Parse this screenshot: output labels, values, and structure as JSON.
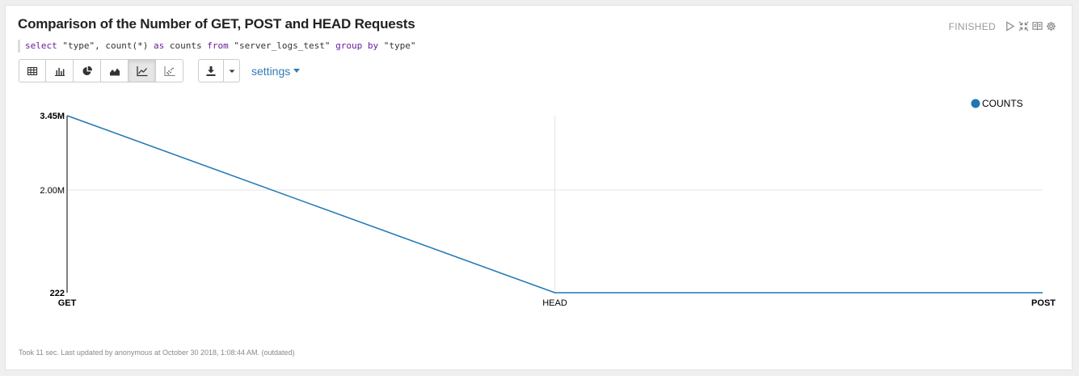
{
  "paragraph": {
    "title": "Comparison of the Number of GET, POST and HEAD Requests",
    "status": "FINISHED",
    "query": {
      "tokens": [
        {
          "t": "select",
          "k": "kw"
        },
        {
          "t": " \"type\", count(*) ",
          "k": "str"
        },
        {
          "t": "as",
          "k": "kw"
        },
        {
          "t": " counts ",
          "k": "str"
        },
        {
          "t": "from",
          "k": "kw"
        },
        {
          "t": " \"server_logs_test\" ",
          "k": "str"
        },
        {
          "t": "group",
          "k": "kw"
        },
        {
          "t": " ",
          "k": "str"
        },
        {
          "t": "by",
          "k": "kw"
        },
        {
          "t": " \"type\"",
          "k": "str"
        }
      ]
    },
    "settings_label": "settings",
    "footer": "Took 11 sec. Last updated by anonymous at October 30 2018, 1:08:44 AM. (outdated)"
  },
  "icons": {
    "controls": [
      "run-icon",
      "collapse-icon",
      "book-icon",
      "gear-icon"
    ],
    "viz": [
      "table-icon",
      "bar-chart-icon",
      "pie-chart-icon",
      "area-chart-icon",
      "line-chart-icon",
      "scatter-chart-icon"
    ],
    "active_viz": "line-chart-icon"
  },
  "colors": {
    "series": "#1f77b4",
    "link": "#337ab7"
  },
  "chart_data": {
    "type": "line",
    "categories": [
      "GET",
      "HEAD",
      "POST"
    ],
    "series": [
      {
        "name": "COUNTS",
        "values": [
          3450000,
          222,
          222
        ]
      }
    ],
    "y_ticks": [
      {
        "value": 3450000,
        "label": "3.45M"
      },
      {
        "value": 2000000,
        "label": "2.00M"
      },
      {
        "value": 222,
        "label": "222"
      }
    ],
    "ylim": [
      222,
      3450000
    ],
    "legend_position": "top-right",
    "grid": true
  }
}
